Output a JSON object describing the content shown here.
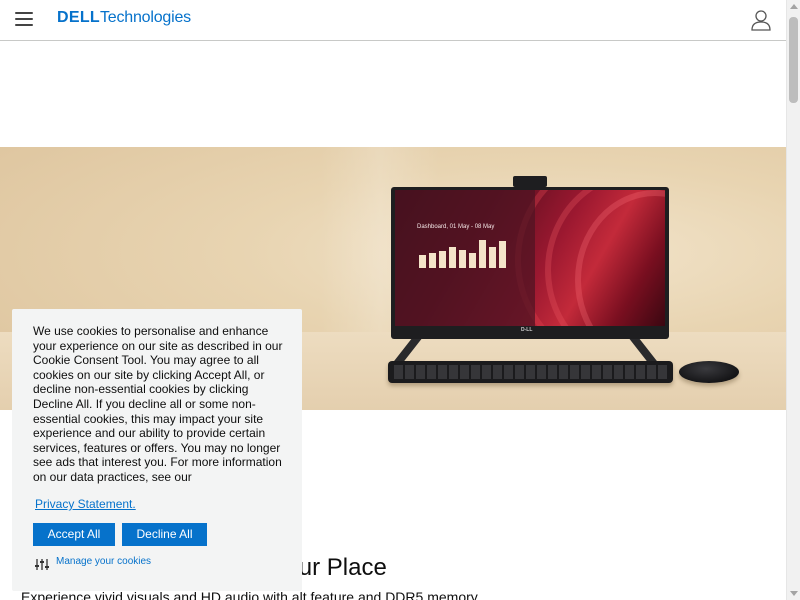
{
  "header": {
    "menu_icon": "hamburger-menu-icon",
    "logo_brand": "DELL",
    "logo_suffix": "Technologies",
    "account_icon": "user-account-icon"
  },
  "hero": {
    "screen_dashboard_title": "Dashboard, 01 May - 08 May",
    "screen_bars": [
      0.45,
      0.55,
      0.6,
      0.75,
      0.65,
      0.55,
      1.0,
      0.75,
      0.95
    ],
    "colors": {
      "accent": "#0672cb",
      "hero_bg": "#e8d4b1",
      "screen_red": "#9b1830"
    }
  },
  "section": {
    "heading": "nto Your Place",
    "subtext": "Experience vivid visuals and HD audio with alt feature and DDR5 memory."
  },
  "cookie_banner": {
    "text": "We use cookies to personalise and enhance your experience on our site as described in our Cookie Consent Tool. You may agree to all cookies on our site by clicking Accept All, or decline non-essential cookies by clicking Decline All. If you decline all or some non-essential cookies, this may impact your site experience and our ability to provide certain services, features or offers. You may no longer see ads that interest you. For more information on our data practices, see our",
    "privacy_link": "Privacy Statement.",
    "accept_label": "Accept All",
    "decline_label": "Decline All",
    "manage_label": "Manage your cookies",
    "manage_icon": "sliders-icon"
  }
}
